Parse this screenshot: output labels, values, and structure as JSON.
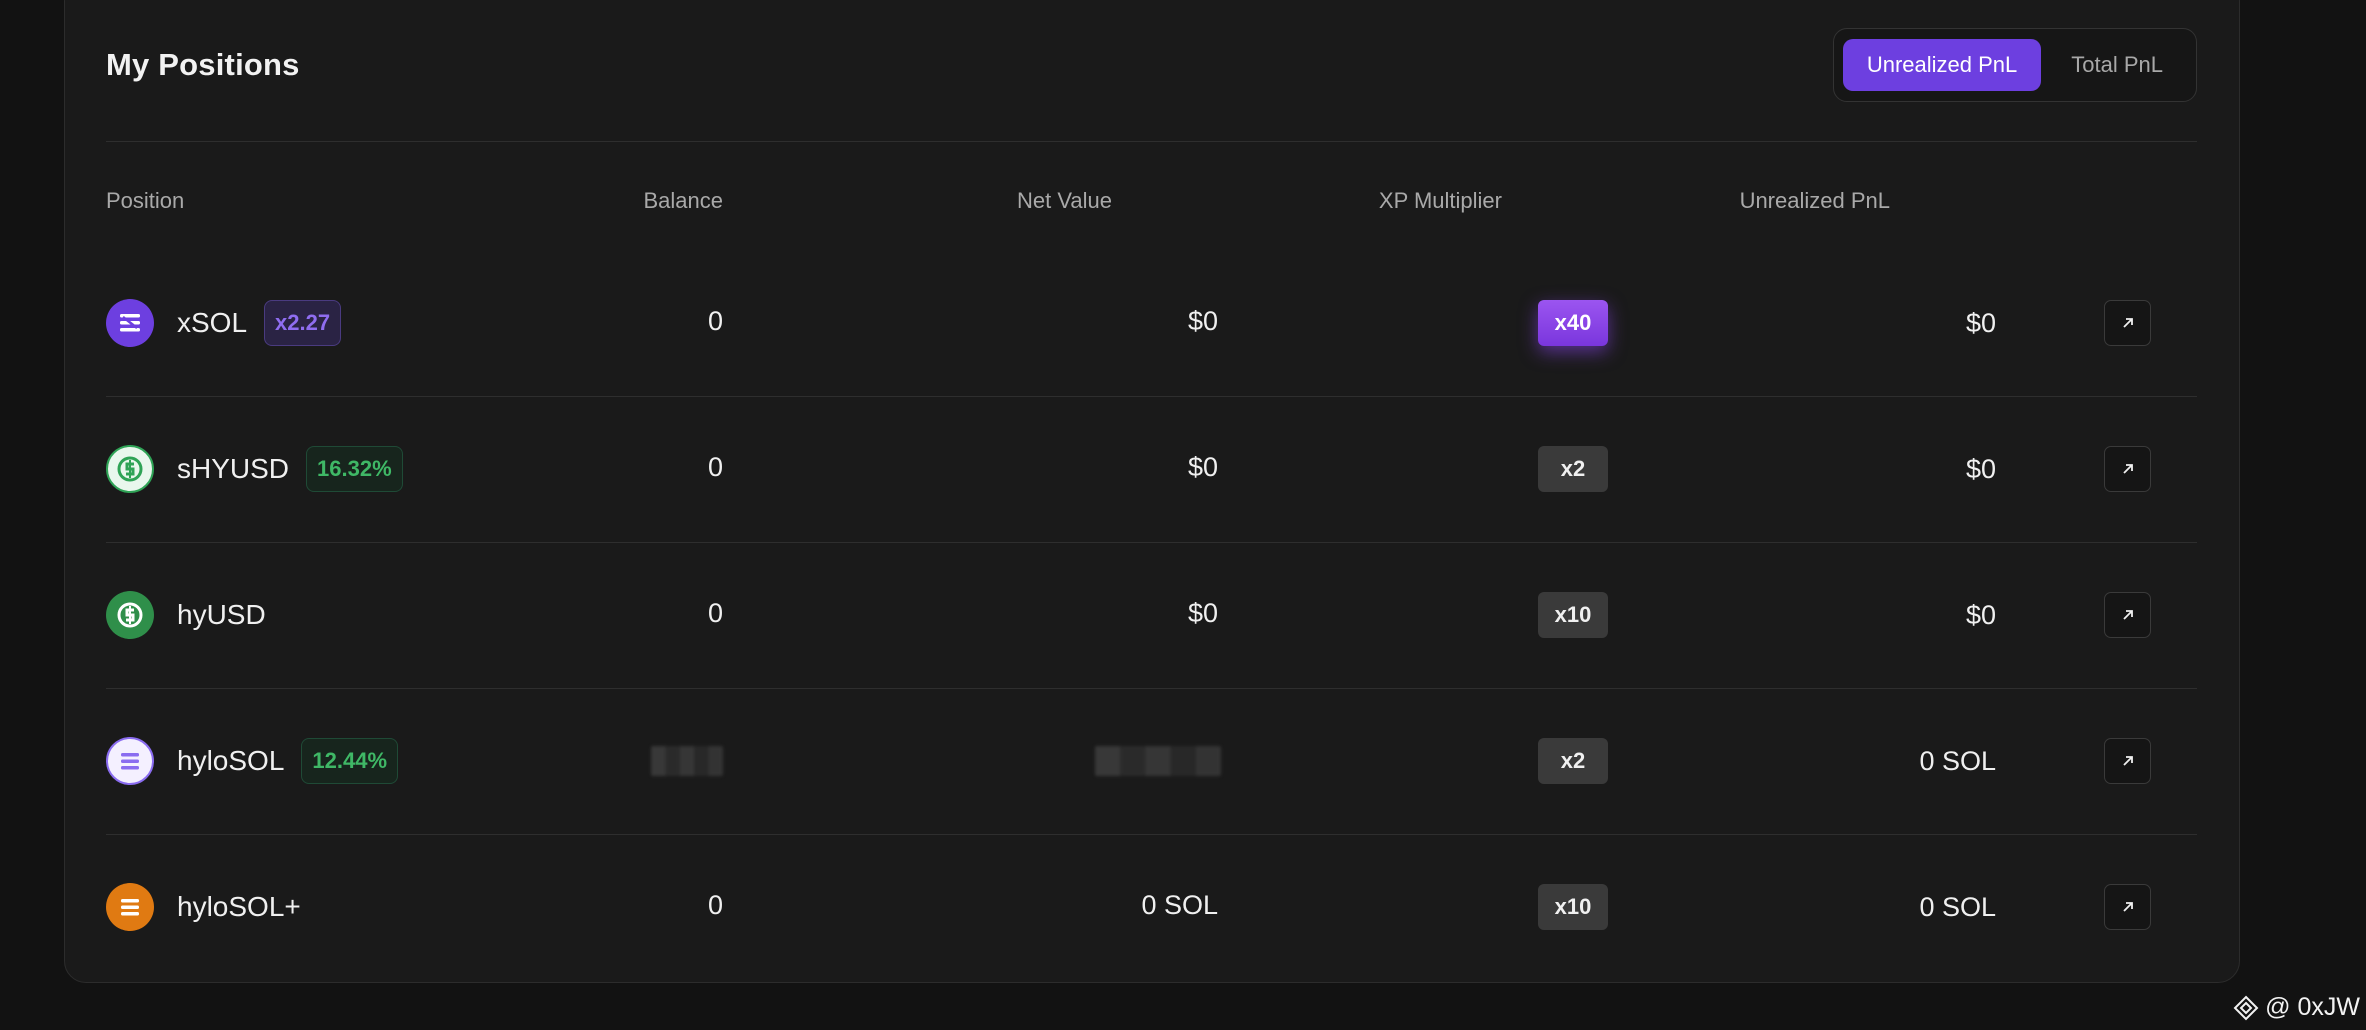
{
  "panel": {
    "title": "My Positions",
    "toggle": {
      "unrealized_label": "Unrealized PnL",
      "total_label": "Total PnL",
      "active": "Unrealized PnL"
    }
  },
  "table": {
    "headers": {
      "position": "Position",
      "balance": "Balance",
      "net_value": "Net Value",
      "xp_multiplier": "XP Multiplier",
      "unrealized_pnl": "Unrealized PnL"
    },
    "rows": [
      {
        "asset": "xSOL",
        "icon": "xsol-icon",
        "icon_color": "#6d3fe0",
        "badge": "x2.27",
        "badge_style": "purple",
        "balance": "0",
        "net_value": "$0",
        "multiplier": "x40",
        "multiplier_highlight": true,
        "pnl": "$0"
      },
      {
        "asset": "sHYUSD",
        "icon": "shyusd-icon",
        "icon_color": "#2fa356",
        "badge": "16.32%",
        "badge_style": "green",
        "balance": "0",
        "net_value": "$0",
        "multiplier": "x2",
        "multiplier_highlight": false,
        "pnl": "$0"
      },
      {
        "asset": "hyUSD",
        "icon": "hyusd-icon",
        "icon_color": "#2f8f4a",
        "badge": "",
        "badge_style": "",
        "balance": "0",
        "net_value": "$0",
        "multiplier": "x10",
        "multiplier_highlight": false,
        "pnl": "$0"
      },
      {
        "asset": "hyloSOL",
        "icon": "hylosol-icon",
        "icon_color": "#8a6cf0",
        "badge": "12.44%",
        "badge_style": "green",
        "balance": "",
        "net_value": "",
        "multiplier": "x2",
        "multiplier_highlight": false,
        "pnl": "0 SOL",
        "obscured": true
      },
      {
        "asset": "hyloSOL+",
        "icon": "hylosol-plus-icon",
        "icon_color": "#e07a12",
        "badge": "",
        "badge_style": "",
        "balance": "0",
        "net_value": "0 SOL",
        "multiplier": "x10",
        "multiplier_highlight": false,
        "pnl": "0 SOL"
      }
    ]
  },
  "watermark": {
    "text": "@ 0xJW"
  },
  "colors": {
    "accent": "#6d3fe0",
    "positive": "#3fb866",
    "background": "#1a1a1a"
  }
}
